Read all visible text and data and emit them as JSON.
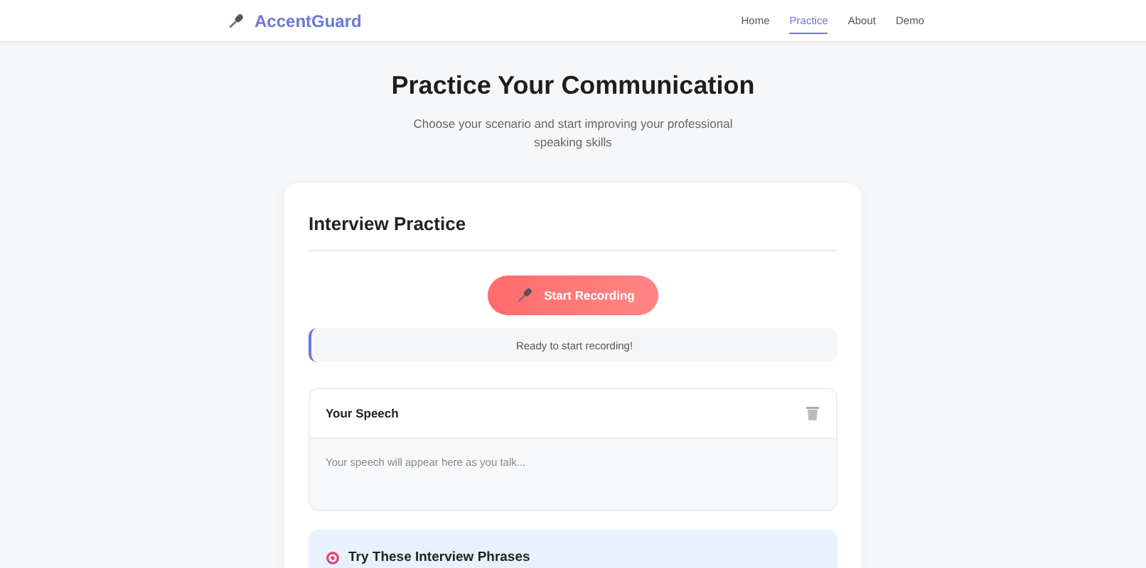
{
  "brand": {
    "name": "AccentGuard"
  },
  "nav": [
    {
      "label": "Home",
      "selected": false
    },
    {
      "label": "Practice",
      "selected": true
    },
    {
      "label": "About",
      "selected": false
    },
    {
      "label": "Demo",
      "selected": false
    }
  ],
  "hero": {
    "title": "Practice Your Communication",
    "subtitle": "Choose your scenario and start improving your professional speaking skills"
  },
  "card": {
    "title": "Interview Practice",
    "record_button": "Start Recording",
    "status": "Ready to start recording!",
    "speech": {
      "title": "Your Speech",
      "placeholder": "Your speech will appear here as you talk..."
    },
    "phrases": {
      "title": "Try These Interview Phrases"
    }
  }
}
